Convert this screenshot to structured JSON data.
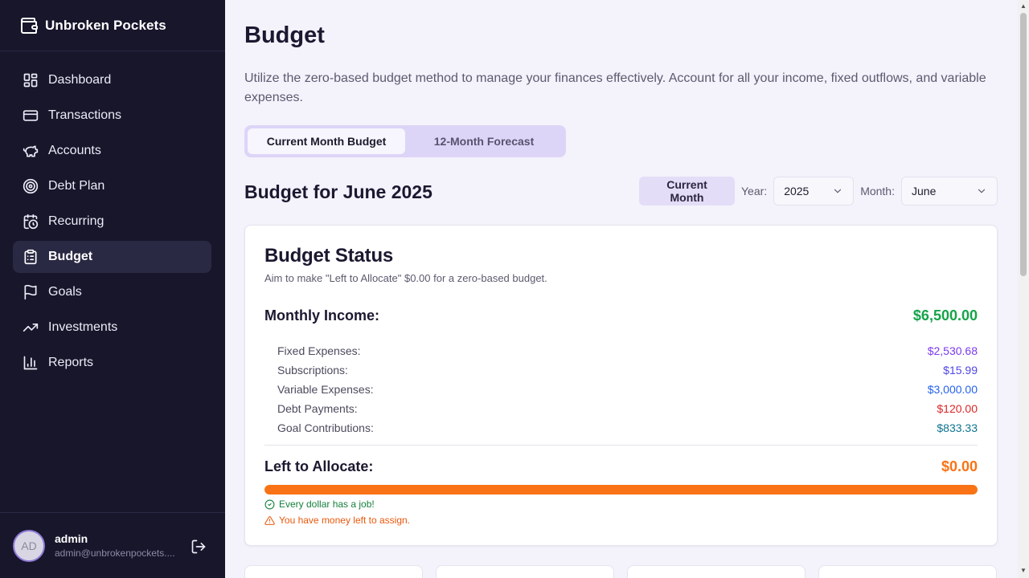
{
  "app": {
    "name": "Unbroken Pockets",
    "logo_icon": "wallet-icon"
  },
  "sidebar": {
    "items": [
      {
        "label": "Dashboard",
        "icon": "dashboard-icon",
        "active": false
      },
      {
        "label": "Transactions",
        "icon": "credit-card-icon",
        "active": false
      },
      {
        "label": "Accounts",
        "icon": "piggy-bank-icon",
        "active": false
      },
      {
        "label": "Debt Plan",
        "icon": "target-icon",
        "active": false
      },
      {
        "label": "Recurring",
        "icon": "calendar-clock-icon",
        "active": false
      },
      {
        "label": "Budget",
        "icon": "clipboard-list-icon",
        "active": true
      },
      {
        "label": "Goals",
        "icon": "flag-icon",
        "active": false
      },
      {
        "label": "Investments",
        "icon": "trending-up-icon",
        "active": false
      },
      {
        "label": "Reports",
        "icon": "bar-chart-icon",
        "active": false
      }
    ]
  },
  "user": {
    "initials": "AD",
    "name": "admin",
    "email": "admin@unbrokenpockets...."
  },
  "page": {
    "title": "Budget",
    "description": "Utilize the zero-based budget method to manage your finances effectively. Account for all your income, fixed outflows, and variable expenses."
  },
  "tabs": [
    {
      "label": "Current Month Budget",
      "active": true
    },
    {
      "label": "12-Month Forecast",
      "active": false
    }
  ],
  "budget_header": {
    "title": "Budget for June 2025",
    "current_month_label": "Current Month",
    "year_label": "Year:",
    "year_value": "2025",
    "month_label": "Month:",
    "month_value": "June"
  },
  "status": {
    "title": "Budget Status",
    "subtitle": "Aim to make \"Left to Allocate\" $0.00 for a zero-based budget.",
    "income_label": "Monthly Income:",
    "income_value": "$6,500.00",
    "items": [
      {
        "label": "Fixed Expenses:",
        "value": "$2,530.68",
        "color": "#7c3aed"
      },
      {
        "label": "Subscriptions:",
        "value": "$15.99",
        "color": "#4f46e5"
      },
      {
        "label": "Variable Expenses:",
        "value": "$3,000.00",
        "color": "#2563eb"
      },
      {
        "label": "Debt Payments:",
        "value": "$120.00",
        "color": "#dc2626"
      },
      {
        "label": "Goal Contributions:",
        "value": "$833.33",
        "color": "#0e7490"
      }
    ],
    "left_label": "Left to Allocate:",
    "left_value": "$0.00",
    "progress_percent": 100,
    "ok_message": "Every dollar has a job!",
    "warn_message": "You have money left to assign."
  },
  "colors": {
    "accent": "#f97316",
    "income": "#16a34a",
    "sidebar_bg": "#17162b"
  }
}
